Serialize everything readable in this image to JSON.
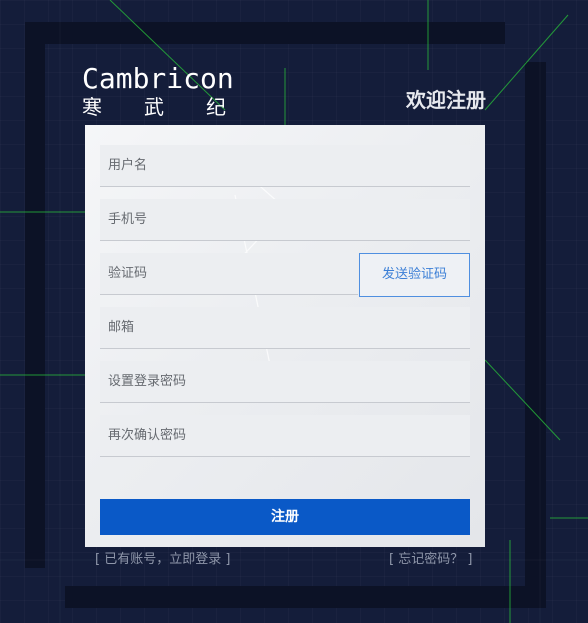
{
  "logo": {
    "wordmark": "Cambricon",
    "cn_chars": [
      "寒",
      "武",
      "纪"
    ]
  },
  "header": {
    "title": "欢迎注册"
  },
  "form": {
    "username_placeholder": "用户名",
    "phone_placeholder": "手机号",
    "code_placeholder": "验证码",
    "send_code_label": "发送验证码",
    "email_placeholder": "邮箱",
    "password_placeholder": "设置登录密码",
    "confirm_placeholder": "再次确认密码",
    "submit_label": "注册"
  },
  "links": {
    "has_account": "[ 已有账号，立即登录 ]",
    "forgot_password": "[ 忘记密码？ ]"
  },
  "colors": {
    "background": "#141d3a",
    "frame": "#0c1226",
    "accent": "#0a59c7",
    "link": "#8f97aa",
    "grid_line": "#2ecc40"
  }
}
